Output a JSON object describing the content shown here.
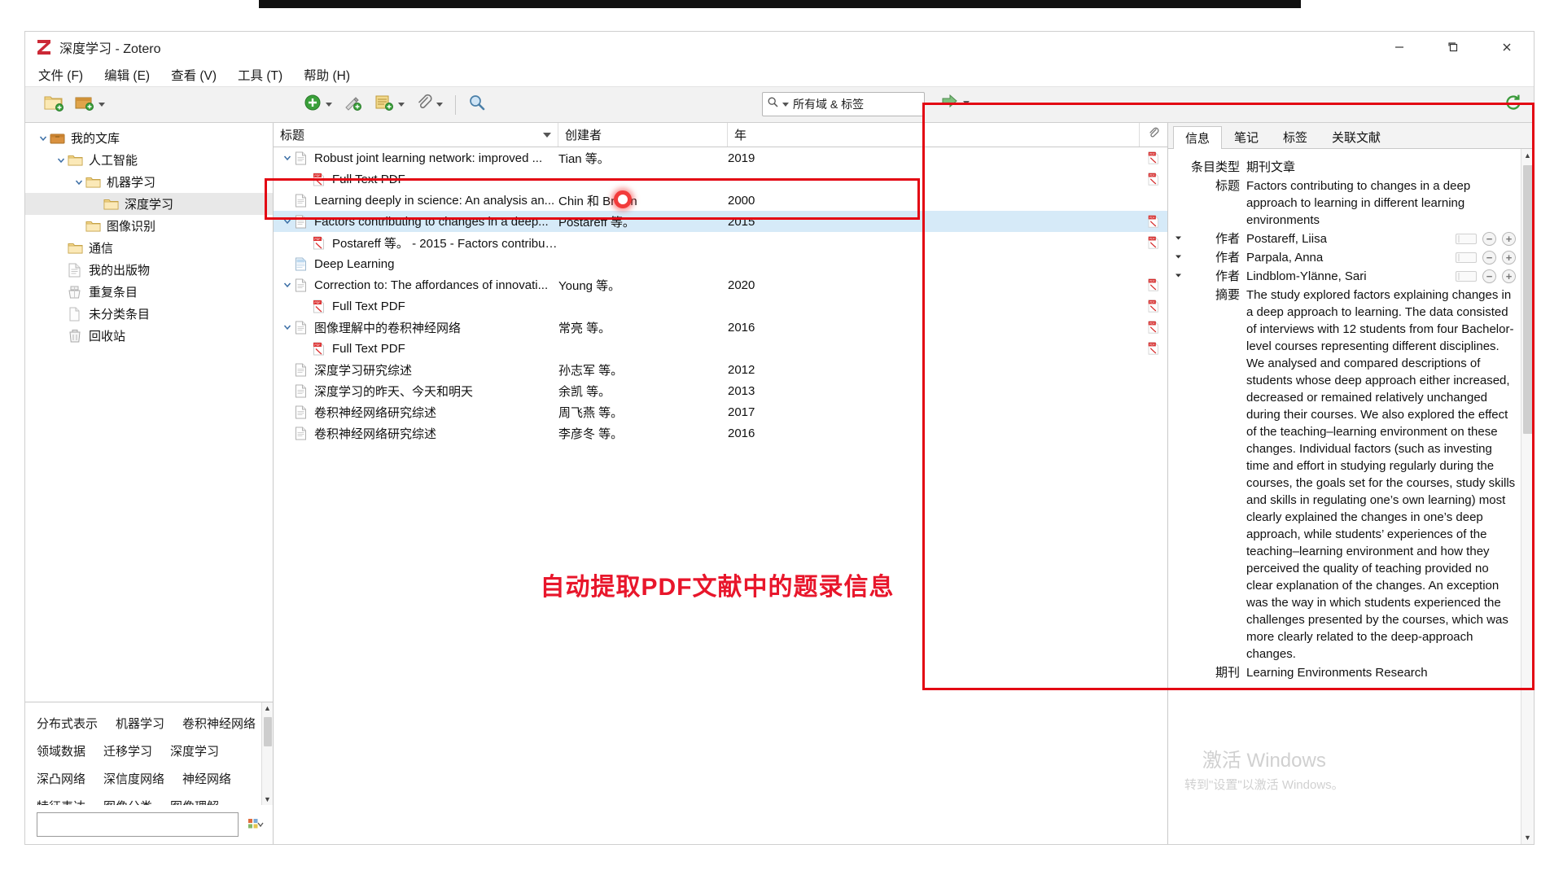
{
  "window": {
    "title": "深度学习 - Zotero",
    "logo_letter": "Z",
    "controls": {
      "minimize": "–",
      "maximize": "❐",
      "close": "✕"
    }
  },
  "menubar": [
    {
      "label": "文件 (F)",
      "name": "menu-file"
    },
    {
      "label": "编辑 (E)",
      "name": "menu-edit"
    },
    {
      "label": "查看 (V)",
      "name": "menu-view"
    },
    {
      "label": "工具 (T)",
      "name": "menu-tools"
    },
    {
      "label": "帮助 (H)",
      "name": "menu-help"
    }
  ],
  "toolbar": {
    "new_collection": "new-collection-icon",
    "new_library": "new-library-icon",
    "new_item": "new-item-icon",
    "add_by_identifier": "add-by-identifier-icon",
    "new_note": "new-note-icon",
    "add_attachment": "add-attachment-icon",
    "advanced_search": "advanced-search-icon",
    "locate": "locate-icon",
    "sync": "sync-icon",
    "search_placeholder": "所有域 & 标签",
    "search_value": ""
  },
  "sidebar": {
    "items": [
      {
        "label": "我的文库",
        "icon": "library-icon",
        "depth": 0,
        "twisty": "open",
        "selected": false
      },
      {
        "label": "人工智能",
        "icon": "folder-icon",
        "depth": 1,
        "twisty": "open",
        "selected": false
      },
      {
        "label": "机器学习",
        "icon": "folder-icon",
        "depth": 2,
        "twisty": "open",
        "selected": false
      },
      {
        "label": "深度学习",
        "icon": "folder-icon",
        "depth": 3,
        "twisty": "none",
        "selected": true
      },
      {
        "label": "图像识别",
        "icon": "folder-icon",
        "depth": 2,
        "twisty": "none",
        "selected": false
      },
      {
        "label": "通信",
        "icon": "folder-icon",
        "depth": 1,
        "twisty": "none",
        "selected": false
      },
      {
        "label": "我的出版物",
        "icon": "publications-icon",
        "depth": 1,
        "twisty": "none",
        "selected": false
      },
      {
        "label": "重复条目",
        "icon": "duplicates-icon",
        "depth": 1,
        "twisty": "none",
        "selected": false
      },
      {
        "label": "未分类条目",
        "icon": "unfiled-icon",
        "depth": 1,
        "twisty": "none",
        "selected": false
      },
      {
        "label": "回收站",
        "icon": "trash-icon",
        "depth": 1,
        "twisty": "none",
        "selected": false
      }
    ]
  },
  "tag_selector": {
    "rows": [
      [
        "分布式表示",
        "机器学习",
        "卷积神经网络"
      ],
      [
        "领域数据",
        "迁移学习",
        "深度学习"
      ],
      [
        "深凸网络",
        "深信度网络",
        "神经网络"
      ],
      [
        "特征表达",
        "图像分类",
        "图像理解"
      ]
    ],
    "filter_value": "",
    "filter_placeholder": ""
  },
  "item_list": {
    "columns": [
      {
        "label": "标题",
        "name": "column-title"
      },
      {
        "label": "创建者",
        "name": "column-creator"
      },
      {
        "label": "年",
        "name": "column-year"
      },
      {
        "label": "",
        "name": "column-attachment"
      }
    ],
    "rows": [
      {
        "title": "Robust joint learning network: improved ...",
        "creator": "Tian 等。",
        "year": "2019",
        "icon": "document-icon",
        "depth": 0,
        "twisty": "open",
        "attachment": "pdf-icon",
        "selected": false
      },
      {
        "title": "Full Text PDF",
        "creator": "",
        "year": "",
        "icon": "pdf-icon",
        "depth": 1,
        "twisty": "none",
        "attachment": "pdf-icon",
        "selected": false
      },
      {
        "title": "Learning deeply in science: An analysis an...",
        "creator": "Chin 和 Brown",
        "year": "2000",
        "icon": "document-icon",
        "depth": 0,
        "twisty": "none",
        "attachment": "",
        "selected": false
      },
      {
        "title": "Factors contributing to changes in a deep...",
        "creator": "Postareff 等。",
        "year": "2015",
        "icon": "document-icon",
        "depth": 0,
        "twisty": "open",
        "attachment": "pdf-icon",
        "selected": true
      },
      {
        "title": "Postareff 等。 - 2015 - Factors contribut...",
        "creator": "",
        "year": "",
        "icon": "pdf-icon",
        "depth": 1,
        "twisty": "none",
        "attachment": "pdf-icon",
        "selected": false
      },
      {
        "title": "Deep Learning",
        "creator": "",
        "year": "",
        "icon": "snapshot-icon",
        "depth": 0,
        "twisty": "none",
        "attachment": "",
        "selected": false
      },
      {
        "title": "Correction to: The affordances of innovati...",
        "creator": "Young 等。",
        "year": "2020",
        "icon": "document-icon",
        "depth": 0,
        "twisty": "open",
        "attachment": "pdf-icon",
        "selected": false
      },
      {
        "title": "Full Text PDF",
        "creator": "",
        "year": "",
        "icon": "pdf-icon",
        "depth": 1,
        "twisty": "none",
        "attachment": "pdf-icon",
        "selected": false
      },
      {
        "title": "图像理解中的卷积神经网络",
        "creator": "常亮 等。",
        "year": "2016",
        "icon": "document-icon",
        "depth": 0,
        "twisty": "open",
        "attachment": "pdf-icon",
        "selected": false
      },
      {
        "title": "Full Text PDF",
        "creator": "",
        "year": "",
        "icon": "pdf-icon",
        "depth": 1,
        "twisty": "none",
        "attachment": "pdf-icon",
        "selected": false
      },
      {
        "title": "深度学习研究综述",
        "creator": "孙志军 等。",
        "year": "2012",
        "icon": "document-icon",
        "depth": 0,
        "twisty": "none",
        "attachment": "",
        "selected": false
      },
      {
        "title": "深度学习的昨天、今天和明天",
        "creator": "余凯 等。",
        "year": "2013",
        "icon": "document-icon",
        "depth": 0,
        "twisty": "none",
        "attachment": "",
        "selected": false
      },
      {
        "title": "卷积神经网络研究综述",
        "creator": "周飞燕 等。",
        "year": "2017",
        "icon": "document-icon",
        "depth": 0,
        "twisty": "none",
        "attachment": "",
        "selected": false
      },
      {
        "title": "卷积神经网络研究综述",
        "creator": "李彦冬 等。",
        "year": "2016",
        "icon": "document-icon",
        "depth": 0,
        "twisty": "none",
        "attachment": "",
        "selected": false
      }
    ]
  },
  "annotation": {
    "text": "自动提取PDF文献中的题录信息",
    "color": "#e8162b"
  },
  "right_panel": {
    "tabs": [
      {
        "label": "信息",
        "name": "tab-info",
        "active": true
      },
      {
        "label": "笔记",
        "name": "tab-notes",
        "active": false
      },
      {
        "label": "标签",
        "name": "tab-tags",
        "active": false
      },
      {
        "label": "关联文献",
        "name": "tab-related",
        "active": false
      }
    ],
    "fields": [
      {
        "label": "条目类型",
        "value": "期刊文章",
        "type": "plain"
      },
      {
        "label": "标题",
        "value": "Factors contributing to changes in a deep approach to learning in different learning environments",
        "type": "plain"
      },
      {
        "label": "作者",
        "value": "Postareff, Liisa",
        "type": "creator"
      },
      {
        "label": "作者",
        "value": "Parpala, Anna",
        "type": "creator"
      },
      {
        "label": "作者",
        "value": "Lindblom-Ylänne, Sari",
        "type": "creator"
      },
      {
        "label": "摘要",
        "value": "The study explored factors explaining changes in a deep approach to learning. The data consisted of interviews with 12 students from four Bachelor-level courses representing different disciplines. We analysed and compared descriptions of students whose deep approach either increased, decreased or remained relatively unchanged during their courses. We also explored the effect of the teaching–learning environment on these changes. Individual factors (such as investing time and effort in studying regularly during the courses, the goals set for the courses, study skills and skills in regulating one’s own learning) most clearly explained the changes in one’s deep approach, while students’ experiences of the teaching–learning environment and how they perceived the quality of teaching provided no clear explanation of the changes. An exception was the way in which students experienced the challenges presented by the courses, which was more clearly related to the deep-approach changes.",
        "type": "plain"
      },
      {
        "label": "期刊",
        "value": "Learning Environments Research",
        "type": "plain"
      }
    ]
  },
  "watermark": {
    "line1": "激活 Windows",
    "line2": "转到\"设置\"以激活 Windows。"
  }
}
